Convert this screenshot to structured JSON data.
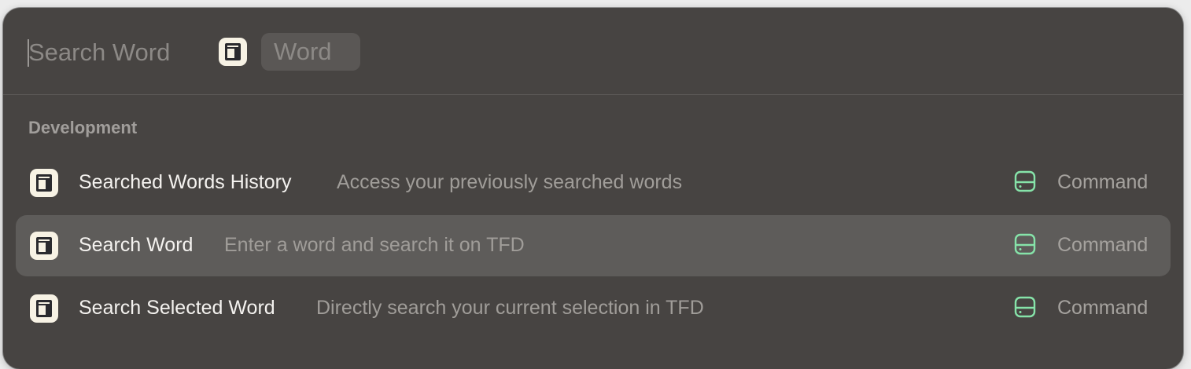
{
  "search": {
    "placeholder": "Search Word",
    "argument_placeholder": "Word"
  },
  "section": {
    "title": "Development"
  },
  "commands": [
    {
      "title": "Searched Words History",
      "subtitle": "Access your previously searched words",
      "type": "Command",
      "selected": false
    },
    {
      "title": "Search Word",
      "subtitle": "Enter a word and search it on TFD",
      "type": "Command",
      "selected": true
    },
    {
      "title": "Search Selected Word",
      "subtitle": "Directly search your current selection in TFD",
      "type": "Command",
      "selected": false
    }
  ],
  "colors": {
    "accent_icon": "#f7f2e4",
    "type_icon": "#86e3a9",
    "window_bg": "#474442",
    "selection_bg": "#5e5c5a"
  },
  "icons": {
    "extension": "book-icon",
    "command_type": "hard-drive-icon"
  }
}
